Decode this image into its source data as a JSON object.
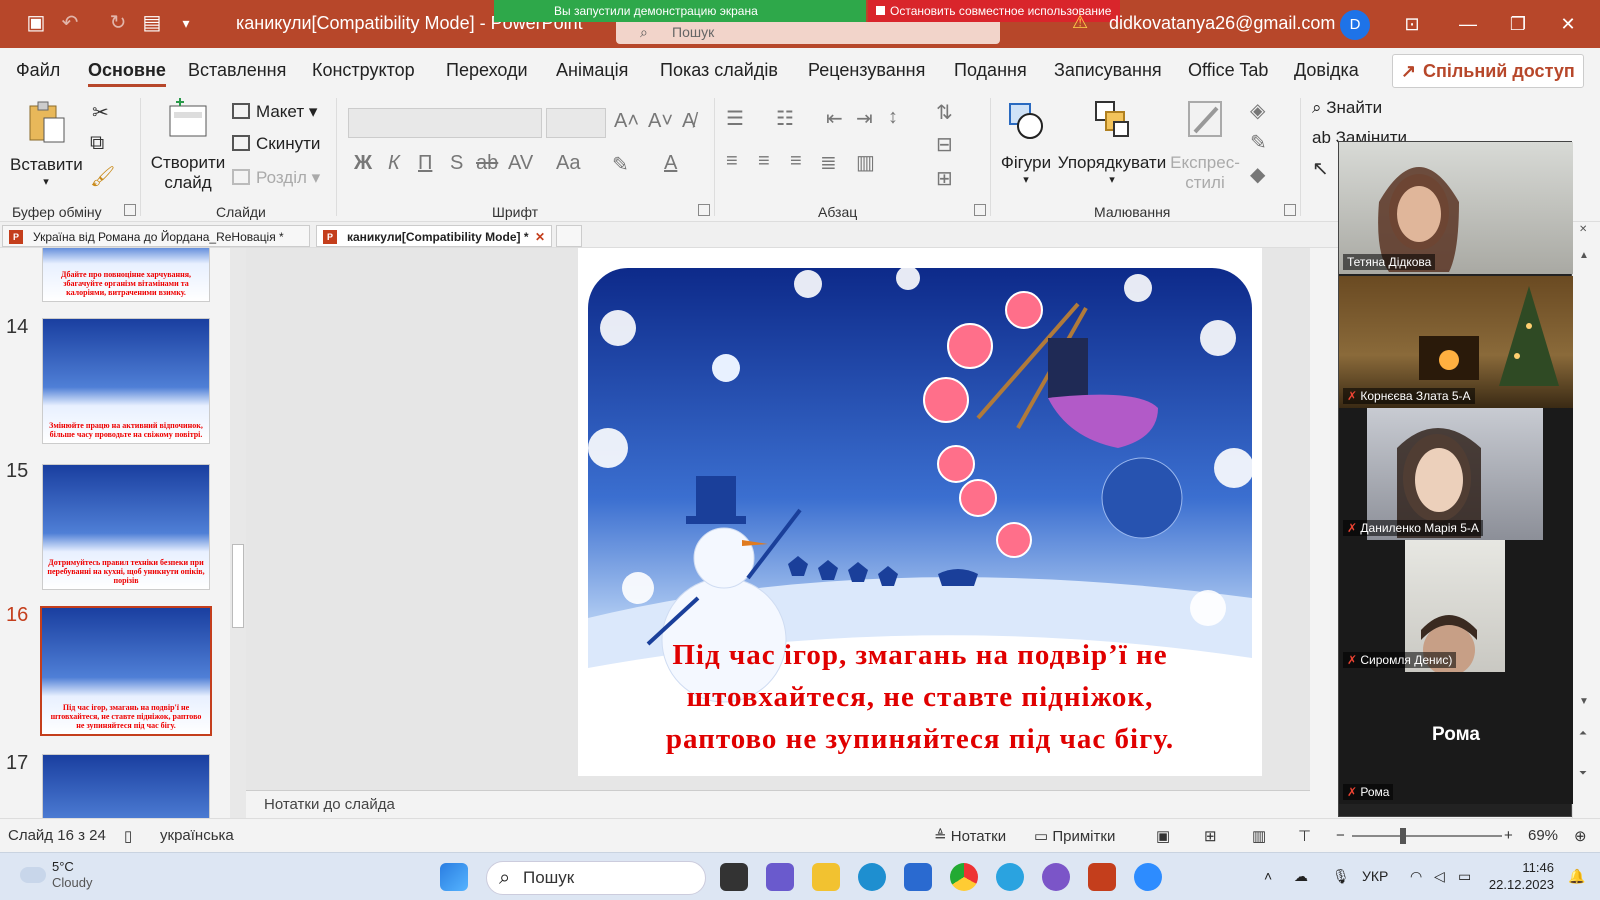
{
  "titlebar": {
    "doc_title": "каникули[Compatibility Mode]  -  PowerPoint",
    "search_placeholder": "Пошук",
    "account_email": "didkovatanya26@gmail.com",
    "avatar_initial": "D",
    "share_banner": "Вы запустили демонстрацию экрана",
    "stop_share": "Остановить совместное использование",
    "color_accent": "#b7472a"
  },
  "menu": {
    "items": [
      "Файл",
      "Основне",
      "Вставлення",
      "Конструктор",
      "Переходи",
      "Анімація",
      "Показ слайдів",
      "Рецензування",
      "Подання",
      "Записування",
      "Office Tab",
      "Довідка"
    ],
    "active": "Основне",
    "share_button": "Спільний доступ"
  },
  "ribbon": {
    "clipboard": {
      "paste": "Вставити",
      "label": "Буфер обміну"
    },
    "slides": {
      "new_slide_1": "Створити",
      "new_slide_2": "слайд",
      "layout": "Макет",
      "reset": "Скинути",
      "section": "Розділ",
      "label": "Слайди"
    },
    "font": {
      "label": "Шрифт",
      "bold": "Ж",
      "italic": "К",
      "underline": "П",
      "shadow": "S",
      "strike": "ab"
    },
    "paragraph": {
      "label": "Абзац"
    },
    "drawing": {
      "shapes": "Фігури",
      "arrange": "Упорядкувати",
      "styles_1": "Експрес-",
      "styles_2": "стилі",
      "label": "Малювання"
    },
    "editing": {
      "find": "Знайти",
      "replace": "Замінити"
    }
  },
  "tabs": [
    {
      "label": "Україна від Романа до Йордана_ReНовація *",
      "active": false
    },
    {
      "label": "каникули[Compatibility Mode] *",
      "active": true
    }
  ],
  "thumbnails": [
    {
      "num": "",
      "caption": "Дбайте про повноцінне харчування, збагачуйте організм вітамінами та калоріями, витраченими взимку."
    },
    {
      "num": "14",
      "caption": "Змінюйте працю на активний відпочинок, більше часу проводьте на свіжому повітрі."
    },
    {
      "num": "15",
      "caption": "Дотримуйтесь правил техніки безпеки при перебуванні на кухні, щоб уникнути опіків, порізів"
    },
    {
      "num": "16",
      "caption": "Під час ігор, змагань на подвір'ї не штовхайтеся, не ставте підніжок, раптово не зупиняйтеся під час бігу."
    },
    {
      "num": "17",
      "caption": ""
    }
  ],
  "slide": {
    "text_lines": [
      "Під час ігор, змагань на подвір’ї не",
      "штовхайтеся, не ставте підніжок,",
      "раптово не зупиняйтеся під час бігу."
    ]
  },
  "notes_placeholder": "Нотатки до слайда",
  "statusbar": {
    "slide_info": "Слайд 16 з 24",
    "language": "українська",
    "notes_btn": "Нотатки",
    "comments_btn": "Примітки",
    "zoom": "69%"
  },
  "zoom_participants": [
    {
      "name": "Тетяна Дідкова",
      "muted": false
    },
    {
      "name": "Корнєєва Злата 5-А",
      "muted": true
    },
    {
      "name": "Даниленко Марія 5-А",
      "muted": true
    },
    {
      "name": "Сиромля Денис)",
      "muted": true
    },
    {
      "name": "Рома",
      "muted": true,
      "big_label": "Рома"
    }
  ],
  "taskbar": {
    "temp": "5°C",
    "weather": "Cloudy",
    "search": "Пошук",
    "lang": "УКР",
    "time": "11:46",
    "date": "22.12.2023"
  }
}
